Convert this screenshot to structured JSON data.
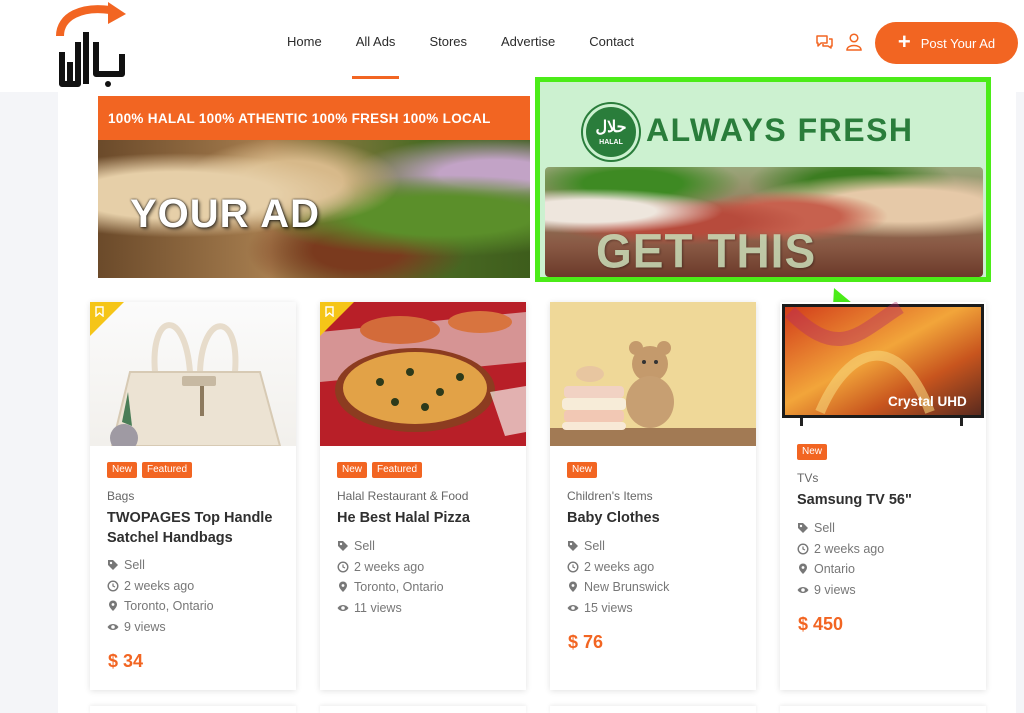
{
  "header": {
    "nav": [
      "Home",
      "All Ads",
      "Stores",
      "Advertise",
      "Contact"
    ],
    "active_nav": "All Ads",
    "post_button_label": "Post Your Ad",
    "accent_color": "#f26522"
  },
  "ads": {
    "left": {
      "strip_text": "100% HALAL 100% ATHENTIC 100% FRESH 100% LOCAL",
      "overlay_text": "YOUR AD"
    },
    "right": {
      "seal_arabic": "حلال",
      "seal_text": "HALAL",
      "headline": "ALWAYS FRESH",
      "cta": "GET THIS SPACE",
      "border_color": "#4bec18"
    }
  },
  "listings": [
    {
      "badges": [
        "New",
        "Featured"
      ],
      "category": "Bags",
      "title": "TWOPAGES Top Handle Satchel Handbags",
      "type": "Sell",
      "time": "2 weeks ago",
      "location": "Toronto, Ontario",
      "views": "9 views",
      "price": "$ 34"
    },
    {
      "badges": [
        "New",
        "Featured"
      ],
      "category": "Halal Restaurant & Food",
      "title": "He Best Halal Pizza",
      "type": "Sell",
      "time": "2 weeks ago",
      "location": "Toronto, Ontario",
      "views": "11 views",
      "price": ""
    },
    {
      "badges": [
        "New"
      ],
      "category": "Children's Items",
      "title": "Baby Clothes",
      "type": "Sell",
      "time": "2 weeks ago",
      "location": "New Brunswick",
      "views": "15 views",
      "price": "$ 76"
    },
    {
      "badges": [
        "New"
      ],
      "category": "TVs",
      "title": "Samsung TV 56\"",
      "type": "Sell",
      "time": "2 weeks ago",
      "location": "Ontario",
      "views": "9 views",
      "price": "$ 450",
      "thumb_text": "Crystal UHD"
    }
  ]
}
